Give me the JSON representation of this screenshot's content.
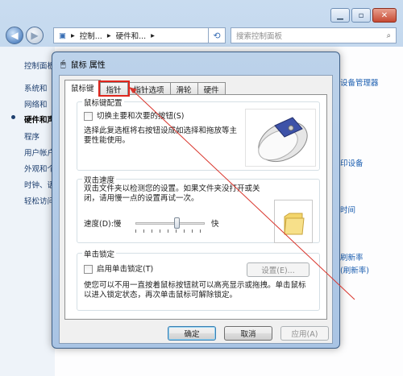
{
  "explorer": {
    "address_parts": [
      "控制...",
      "硬件和..."
    ],
    "search_placeholder": "搜索控制面板",
    "left_nav": [
      {
        "label": "控制面板"
      },
      {
        "label": "系统和"
      },
      {
        "label": "网络和"
      },
      {
        "label": "硬件和声"
      },
      {
        "label": "程序"
      },
      {
        "label": "用户帐户"
      },
      {
        "label": "外观和个"
      },
      {
        "label": "时钟、语"
      },
      {
        "label": "轻松访问"
      }
    ],
    "right_links": [
      "设备管理器",
      "印设备",
      "时间",
      "刷新率",
      "(刷新率)"
    ]
  },
  "dialog": {
    "title": "鼠标 属性",
    "tabs": [
      "鼠标键",
      "指针",
      "指针选项",
      "滑轮",
      "硬件"
    ],
    "active_tab": "鼠标键",
    "highlighted_tab": "指针",
    "button_config": {
      "title": "鼠标键配置",
      "switch_label": "切换主要和次要的按钮(S)",
      "switch_checked": false,
      "description": "选择此复选框将右按钮设成如选择和拖放等主要性能使用。"
    },
    "double_click": {
      "title": "双击速度",
      "description": "双击文件夹以检测您的设置。如果文件夹没打开或关闭，请用慢一点的设置再试一次。",
      "speed_label": "速度(D):慢",
      "fast_label": "快",
      "speed_value": 0.6
    },
    "click_lock": {
      "title": "单击锁定",
      "enable_label": "启用单击锁定(T)",
      "enable_checked": false,
      "settings_button": "设置(E)...",
      "description": "使您可以不用一直按着鼠标按钮就可以高亮显示或拖拽。单击鼠标以进入锁定状态，再次单击鼠标可解除锁定。"
    },
    "buttons": {
      "ok": "确定",
      "cancel": "取消",
      "apply": "应用(A)"
    }
  },
  "colors": {
    "highlight": "#e0251c",
    "accent": "#3c7fb1"
  }
}
